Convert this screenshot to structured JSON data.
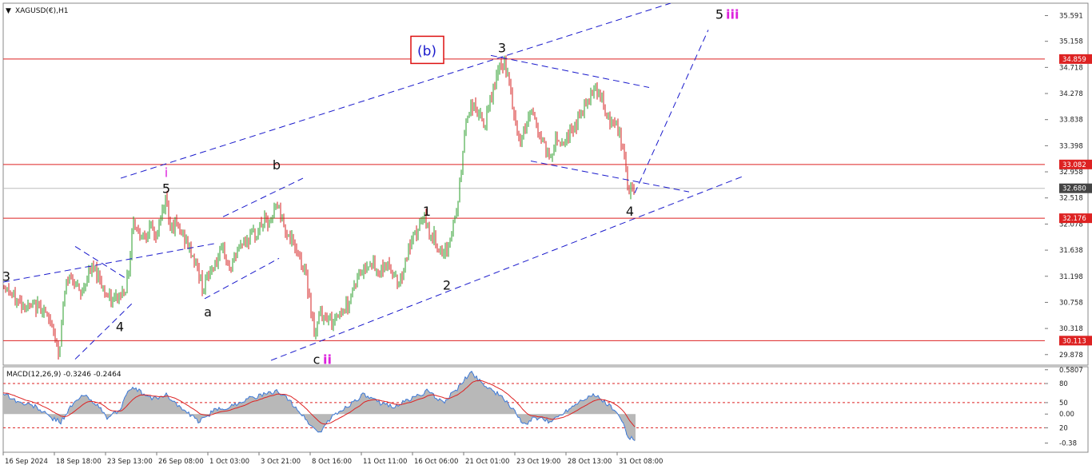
{
  "window": {
    "title": "XAGUSD(€),H1",
    "menu_icon": "triangle-down-icon"
  },
  "colors": {
    "bull": "#2a9d2a",
    "bear": "#d42020",
    "level_line": "#dd2222",
    "channel": "#1a1acc",
    "wave_black": "#111111",
    "wave_magenta": "#dd22dd",
    "wave_blue": "#1a1acc",
    "macd_hist": "#b8b8b8",
    "macd_line": "#3a78d8",
    "signal_line": "#dd2222",
    "current_price_bg": "#444444"
  },
  "chart_data": {
    "type": "candlestick",
    "symbol": "XAGUSD(€)",
    "timeframe": "H1",
    "ylim": [
      29.7,
      35.8
    ],
    "grid": false,
    "price_ticks": [
      "35.591",
      "35.158",
      "34.718",
      "34.278",
      "33.838",
      "33.398",
      "32.958",
      "32.518",
      "32.078",
      "31.638",
      "31.198",
      "30.758",
      "30.318",
      "29.878"
    ],
    "price_tick_values": [
      35.591,
      35.158,
      34.718,
      34.278,
      33.838,
      33.398,
      32.958,
      32.518,
      32.078,
      31.638,
      31.198,
      30.758,
      30.318,
      29.878
    ],
    "time_labels": [
      "16 Sep 2024",
      "18 Sep 18:00",
      "23 Sep 13:00",
      "26 Sep 08:00",
      "1 Oct 03:00",
      "3 Oct 21:00",
      "8 Oct 16:00",
      "11 Oct 11:00",
      "16 Oct 06:00",
      "21 Oct 01:00",
      "23 Oct 19:00",
      "28 Oct 13:00",
      "31 Oct 08:00"
    ],
    "horizontal_levels": [
      {
        "label": "34.859",
        "value": 34.859
      },
      {
        "label": "33.082",
        "value": 33.082
      },
      {
        "label": "32.176",
        "value": 32.176
      },
      {
        "label": "30.113",
        "value": 30.113
      }
    ],
    "current_price": {
      "label": "32.680",
      "value": 32.68
    },
    "price_path": [
      {
        "t": 0,
        "p": 31.05
      },
      {
        "t": 15,
        "p": 30.8
      },
      {
        "t": 35,
        "p": 30.65
      },
      {
        "t": 48,
        "p": 30.7
      },
      {
        "t": 56,
        "p": 30.45
      },
      {
        "t": 62,
        "p": 30.4
      },
      {
        "t": 66,
        "p": 30.1
      },
      {
        "t": 70,
        "p": 29.8
      },
      {
        "t": 74,
        "p": 30.6
      },
      {
        "t": 80,
        "p": 31.15
      },
      {
        "t": 88,
        "p": 31.2
      },
      {
        "t": 96,
        "p": 30.85
      },
      {
        "t": 104,
        "p": 31.15
      },
      {
        "t": 112,
        "p": 31.35
      },
      {
        "t": 120,
        "p": 31.2
      },
      {
        "t": 128,
        "p": 30.9
      },
      {
        "t": 136,
        "p": 30.75
      },
      {
        "t": 142,
        "p": 30.85
      },
      {
        "t": 148,
        "p": 30.9
      },
      {
        "t": 154,
        "p": 31.05
      },
      {
        "t": 158,
        "p": 31.4
      },
      {
        "t": 162,
        "p": 32.2
      },
      {
        "t": 168,
        "p": 31.95
      },
      {
        "t": 176,
        "p": 31.9
      },
      {
        "t": 184,
        "p": 32.0
      },
      {
        "t": 192,
        "p": 31.85
      },
      {
        "t": 200,
        "p": 32.35
      },
      {
        "t": 204,
        "p": 32.55
      },
      {
        "t": 208,
        "p": 32.1
      },
      {
        "t": 216,
        "p": 32.05
      },
      {
        "t": 224,
        "p": 31.9
      },
      {
        "t": 232,
        "p": 31.7
      },
      {
        "t": 240,
        "p": 31.45
      },
      {
        "t": 250,
        "p": 31.0
      },
      {
        "t": 258,
        "p": 31.25
      },
      {
        "t": 266,
        "p": 31.45
      },
      {
        "t": 276,
        "p": 31.6
      },
      {
        "t": 284,
        "p": 31.3
      },
      {
        "t": 292,
        "p": 31.6
      },
      {
        "t": 300,
        "p": 31.8
      },
      {
        "t": 310,
        "p": 31.85
      },
      {
        "t": 318,
        "p": 31.95
      },
      {
        "t": 326,
        "p": 32.15
      },
      {
        "t": 334,
        "p": 32.05
      },
      {
        "t": 342,
        "p": 32.45
      },
      {
        "t": 348,
        "p": 32.2
      },
      {
        "t": 356,
        "p": 31.9
      },
      {
        "t": 364,
        "p": 31.7
      },
      {
        "t": 372,
        "p": 31.5
      },
      {
        "t": 380,
        "p": 31.1
      },
      {
        "t": 386,
        "p": 30.6
      },
      {
        "t": 390,
        "p": 30.15
      },
      {
        "t": 396,
        "p": 30.6
      },
      {
        "t": 404,
        "p": 30.55
      },
      {
        "t": 412,
        "p": 30.4
      },
      {
        "t": 420,
        "p": 30.6
      },
      {
        "t": 430,
        "p": 30.7
      },
      {
        "t": 440,
        "p": 31.1
      },
      {
        "t": 450,
        "p": 31.3
      },
      {
        "t": 460,
        "p": 31.5
      },
      {
        "t": 468,
        "p": 31.2
      },
      {
        "t": 476,
        "p": 31.4
      },
      {
        "t": 486,
        "p": 31.3
      },
      {
        "t": 496,
        "p": 31.1
      },
      {
        "t": 506,
        "p": 31.6
      },
      {
        "t": 516,
        "p": 31.9
      },
      {
        "t": 526,
        "p": 32.2
      },
      {
        "t": 534,
        "p": 31.9
      },
      {
        "t": 542,
        "p": 31.8
      },
      {
        "t": 550,
        "p": 31.45
      },
      {
        "t": 558,
        "p": 31.8
      },
      {
        "t": 566,
        "p": 32.2
      },
      {
        "t": 572,
        "p": 32.8
      },
      {
        "t": 578,
        "p": 33.8
      },
      {
        "t": 586,
        "p": 34.1
      },
      {
        "t": 594,
        "p": 33.95
      },
      {
        "t": 602,
        "p": 33.7
      },
      {
        "t": 610,
        "p": 34.2
      },
      {
        "t": 618,
        "p": 34.6
      },
      {
        "t": 626,
        "p": 34.8
      },
      {
        "t": 632,
        "p": 34.5
      },
      {
        "t": 638,
        "p": 34.0
      },
      {
        "t": 644,
        "p": 33.5
      },
      {
        "t": 652,
        "p": 33.6
      },
      {
        "t": 660,
        "p": 34.05
      },
      {
        "t": 668,
        "p": 33.7
      },
      {
        "t": 676,
        "p": 33.4
      },
      {
        "t": 684,
        "p": 33.2
      },
      {
        "t": 692,
        "p": 33.55
      },
      {
        "t": 700,
        "p": 33.45
      },
      {
        "t": 708,
        "p": 33.6
      },
      {
        "t": 716,
        "p": 33.75
      },
      {
        "t": 724,
        "p": 34.0
      },
      {
        "t": 732,
        "p": 34.2
      },
      {
        "t": 740,
        "p": 34.45
      },
      {
        "t": 748,
        "p": 34.2
      },
      {
        "t": 756,
        "p": 33.8
      },
      {
        "t": 764,
        "p": 33.8
      },
      {
        "t": 772,
        "p": 33.5
      },
      {
        "t": 778,
        "p": 33.2
      },
      {
        "t": 782,
        "p": 32.55
      },
      {
        "t": 786,
        "p": 32.7
      },
      {
        "t": 790,
        "p": 32.68
      }
    ],
    "wave_labels": [
      {
        "text": "(b)",
        "color": "wave_blue",
        "boxed": true,
        "t": 530,
        "p": 35.0
      },
      {
        "text": "3",
        "color": "wave_black",
        "t": 624,
        "p": 35.05
      },
      {
        "text": "5",
        "color": "wave_black",
        "t": 896,
        "p": 35.62,
        "suffix": "iii",
        "suffix_color": "wave_magenta"
      },
      {
        "text": "i",
        "color": "wave_magenta",
        "t": 204,
        "p": 32.95
      },
      {
        "text": "5",
        "color": "wave_black",
        "t": 204,
        "p": 32.68
      },
      {
        "text": "b",
        "color": "wave_black",
        "t": 342,
        "p": 33.08
      },
      {
        "text": "1",
        "color": "wave_black",
        "t": 530,
        "p": 32.3
      },
      {
        "text": "4",
        "color": "wave_black",
        "t": 784,
        "p": 32.3
      },
      {
        "text": "2",
        "color": "wave_black",
        "t": 555,
        "p": 31.05
      },
      {
        "text": "a",
        "color": "wave_black",
        "t": 256,
        "p": 30.6
      },
      {
        "text": "4",
        "color": "wave_black",
        "t": 146,
        "p": 30.35
      },
      {
        "text": "3",
        "color": "wave_black",
        "t": 4,
        "p": 31.2
      },
      {
        "text": "c",
        "color": "wave_black",
        "t": 392,
        "p": 29.8,
        "suffix": "ii",
        "suffix_color": "wave_magenta"
      }
    ],
    "channel_lines": [
      {
        "from": {
          "t": 147,
          "p": 32.85
        },
        "to": {
          "t": 835,
          "p": 35.8
        }
      },
      {
        "from": {
          "t": 335,
          "p": 29.78
        },
        "to": {
          "t": 925,
          "p": 32.88
        }
      },
      {
        "from": {
          "t": 610,
          "p": 34.92
        },
        "to": {
          "t": 808,
          "p": 34.38
        }
      },
      {
        "from": {
          "t": 660,
          "p": 33.14
        },
        "to": {
          "t": 858,
          "p": 32.62
        }
      },
      {
        "from": {
          "t": 0,
          "p": 31.1
        },
        "to": {
          "t": 265,
          "p": 31.75
        }
      },
      {
        "from": {
          "t": 90,
          "p": 31.7
        },
        "to": {
          "t": 155,
          "p": 31.15
        }
      },
      {
        "from": {
          "t": 90,
          "p": 29.8
        },
        "to": {
          "t": 162,
          "p": 30.75
        }
      },
      {
        "from": {
          "t": 275,
          "p": 32.2
        },
        "to": {
          "t": 375,
          "p": 32.85
        }
      },
      {
        "from": {
          "t": 252,
          "p": 30.82
        },
        "to": {
          "t": 345,
          "p": 31.5
        }
      },
      {
        "from": {
          "t": 790,
          "p": 32.6
        },
        "to": {
          "t": 882,
          "p": 35.35
        }
      }
    ],
    "macd": {
      "title": "MACD(12,26,9) -0.3246 -0.2464",
      "params": "12,26,9",
      "main": -0.3246,
      "signal": -0.2464,
      "ylim": [
        -0.5,
        0.62
      ],
      "tick_labels": [
        "0.5807",
        "80",
        "50",
        "0.00",
        "20",
        "-0.38"
      ],
      "tick_values": [
        0.5807,
        0.4,
        0.15,
        0.0,
        -0.18,
        -0.38
      ],
      "dotted_levels": [
        0.4,
        0.15,
        -0.18
      ],
      "path": [
        {
          "t": 0,
          "m": 0.28
        },
        {
          "t": 20,
          "m": 0.15
        },
        {
          "t": 40,
          "m": 0.1
        },
        {
          "t": 60,
          "m": -0.05
        },
        {
          "t": 72,
          "m": -0.1
        },
        {
          "t": 85,
          "m": 0.1
        },
        {
          "t": 100,
          "m": 0.25
        },
        {
          "t": 115,
          "m": 0.15
        },
        {
          "t": 130,
          "m": -0.05
        },
        {
          "t": 145,
          "m": 0.05
        },
        {
          "t": 160,
          "m": 0.35
        },
        {
          "t": 170,
          "m": 0.3
        },
        {
          "t": 185,
          "m": 0.2
        },
        {
          "t": 205,
          "m": 0.25
        },
        {
          "t": 225,
          "m": 0.05
        },
        {
          "t": 245,
          "m": -0.1
        },
        {
          "t": 265,
          "m": 0.05
        },
        {
          "t": 285,
          "m": 0.1
        },
        {
          "t": 305,
          "m": 0.2
        },
        {
          "t": 325,
          "m": 0.25
        },
        {
          "t": 345,
          "m": 0.3
        },
        {
          "t": 365,
          "m": 0.1
        },
        {
          "t": 385,
          "m": -0.15
        },
        {
          "t": 395,
          "m": -0.25
        },
        {
          "t": 410,
          "m": -0.05
        },
        {
          "t": 430,
          "m": 0.1
        },
        {
          "t": 450,
          "m": 0.25
        },
        {
          "t": 470,
          "m": 0.15
        },
        {
          "t": 490,
          "m": 0.1
        },
        {
          "t": 510,
          "m": 0.2
        },
        {
          "t": 530,
          "m": 0.3
        },
        {
          "t": 550,
          "m": 0.15
        },
        {
          "t": 570,
          "m": 0.35
        },
        {
          "t": 585,
          "m": 0.55
        },
        {
          "t": 600,
          "m": 0.4
        },
        {
          "t": 620,
          "m": 0.25
        },
        {
          "t": 640,
          "m": 0.05
        },
        {
          "t": 650,
          "m": -0.15
        },
        {
          "t": 665,
          "m": -0.05
        },
        {
          "t": 685,
          "m": -0.1
        },
        {
          "t": 705,
          "m": 0.05
        },
        {
          "t": 725,
          "m": 0.2
        },
        {
          "t": 740,
          "m": 0.25
        },
        {
          "t": 760,
          "m": 0.1
        },
        {
          "t": 775,
          "m": -0.1
        },
        {
          "t": 782,
          "m": -0.32
        },
        {
          "t": 790,
          "m": -0.32
        }
      ]
    }
  }
}
